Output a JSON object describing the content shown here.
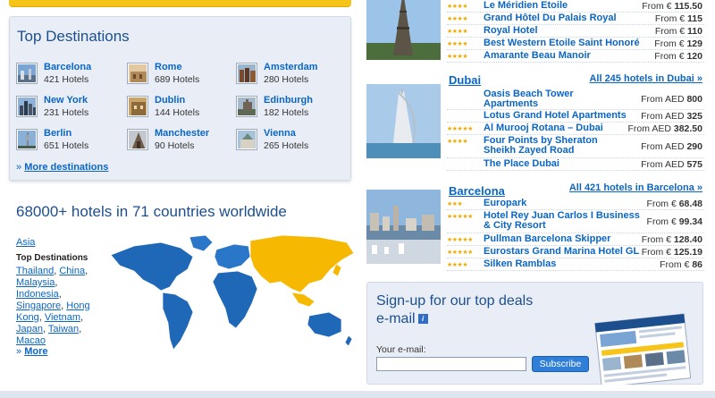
{
  "top_destinations": {
    "title": "Top Destinations",
    "items": [
      {
        "name": "Barcelona",
        "count": "421 Hotels"
      },
      {
        "name": "Rome",
        "count": "689 Hotels"
      },
      {
        "name": "Amsterdam",
        "count": "280 Hotels"
      },
      {
        "name": "New York",
        "count": "231 Hotels"
      },
      {
        "name": "Dublin",
        "count": "144 Hotels"
      },
      {
        "name": "Edinburgh",
        "count": "182 Hotels"
      },
      {
        "name": "Berlin",
        "count": "651 Hotels"
      },
      {
        "name": "Manchester",
        "count": "90 Hotels"
      },
      {
        "name": "Vienna",
        "count": "265 Hotels"
      }
    ],
    "more_prefix": "»",
    "more_label": "More destinations"
  },
  "worldwide": {
    "title": "68000+ hotels in 71 countries worldwide",
    "region": "Asia",
    "top_label": "Top Destinations",
    "countries": [
      "Thailand",
      "China",
      "Malaysia",
      "Indonesia",
      "Singapore",
      "Hong Kong",
      "Vietnam",
      "Japan",
      "Taiwan",
      "Macao"
    ],
    "more_prefix": "»",
    "more_label": "More",
    "highlight_color": "#f6b800",
    "map_color": "#1f68b8"
  },
  "paris": {
    "hotels": [
      {
        "stars": "★★★★",
        "name": "Le Méridien Etoile",
        "price_prefix": "From €",
        "price": "115.50"
      },
      {
        "stars": "★★★★",
        "name": "Grand Hôtel Du Palais Royal",
        "price_prefix": "From €",
        "price": "115"
      },
      {
        "stars": "★★★★",
        "name": "Royal Hotel",
        "price_prefix": "From €",
        "price": "110"
      },
      {
        "stars": "★★★★",
        "name": "Best Western Etoile Saint Honoré",
        "price_prefix": "From €",
        "price": "129"
      },
      {
        "stars": "★★★★",
        "name": "Amarante Beau Manoir",
        "price_prefix": "From €",
        "price": "120"
      }
    ]
  },
  "dubai": {
    "city": "Dubai",
    "all_link": "All 245 hotels in Dubai »",
    "hotels": [
      {
        "stars": "",
        "name": "Oasis Beach Tower Apartments",
        "price_prefix": "From AED",
        "price": "800"
      },
      {
        "stars": "",
        "name": "Lotus Grand Hotel Apartments",
        "price_prefix": "From AED",
        "price": "325"
      },
      {
        "stars": "★★★★★",
        "name": "Al Murooj Rotana – Dubai",
        "price_prefix": "From AED",
        "price": "382.50"
      },
      {
        "stars": "★★★★",
        "name": "Four Points by Sheraton Sheikh Zayed Road",
        "price_prefix": "From AED",
        "price": "290"
      },
      {
        "stars": "",
        "name": "The Place Dubai",
        "price_prefix": "From AED",
        "price": "575"
      }
    ]
  },
  "barcelona": {
    "city": "Barcelona",
    "all_link": "All 421 hotels in Barcelona »",
    "hotels": [
      {
        "stars": "★★★",
        "name": "Europark",
        "price_prefix": "From €",
        "price": "68.48"
      },
      {
        "stars": "★★★★★",
        "name": "Hotel Rey Juan Carlos I Business & City Resort",
        "price_prefix": "From €",
        "price": "99.34"
      },
      {
        "stars": "★★★★★",
        "name": "Pullman Barcelona Skipper",
        "price_prefix": "From €",
        "price": "128.40"
      },
      {
        "stars": "★★★★★",
        "name": "Eurostars Grand Marina Hotel GL",
        "price_prefix": "From €",
        "price": "125.19"
      },
      {
        "stars": "★★★★",
        "name": "Silken Ramblas",
        "price_prefix": "From €",
        "price": "86"
      }
    ]
  },
  "signup": {
    "title_line1": "Sign-up for our top deals",
    "title_line2": "e-mail",
    "info_icon": "i",
    "email_label": "Your e-mail:",
    "email_value": "",
    "subscribe_label": "Subscribe"
  },
  "colors": {
    "accent_yellow": "#f7c51a",
    "link_blue": "#0b66c3",
    "panel_bg": "#e9eef6",
    "star": "#f2a900"
  }
}
